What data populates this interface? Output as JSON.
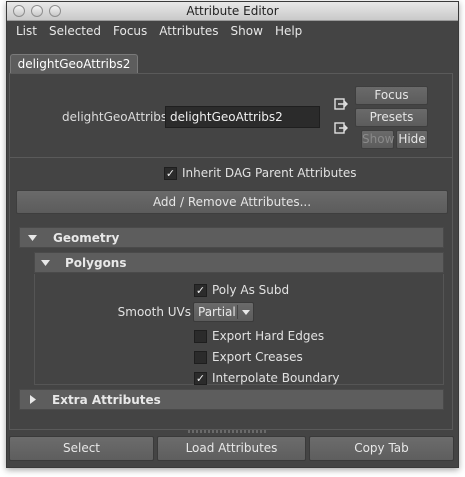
{
  "window": {
    "title": "Attribute Editor"
  },
  "menu": [
    "List",
    "Selected",
    "Focus",
    "Attributes",
    "Show",
    "Help"
  ],
  "tab": {
    "label": "delightGeoAttribs2"
  },
  "node": {
    "label": "delightGeoAttribs:",
    "value": "delightGeoAttribs2"
  },
  "buttons": {
    "focus": "Focus",
    "presets": "Presets",
    "show": "Show",
    "hide": "Hide",
    "add_remove": "Add / Remove Attributes..."
  },
  "inherit": {
    "label": "Inherit DAG Parent Attributes",
    "checked": true
  },
  "sections": {
    "geometry": "Geometry",
    "polygons": "Polygons",
    "extra": "Extra Attributes"
  },
  "polygons": {
    "poly_as_subd": {
      "label": "Poly As Subd",
      "checked": true
    },
    "smooth_uvs": {
      "label": "Smooth UVs",
      "value": "Partial"
    },
    "export_hard_edges": {
      "label": "Export Hard Edges",
      "checked": false
    },
    "export_creases": {
      "label": "Export Creases",
      "checked": false
    },
    "interpolate_boundary": {
      "label": "Interpolate Boundary",
      "checked": true
    }
  },
  "bottom": {
    "select": "Select",
    "load": "Load Attributes",
    "copy": "Copy Tab"
  }
}
